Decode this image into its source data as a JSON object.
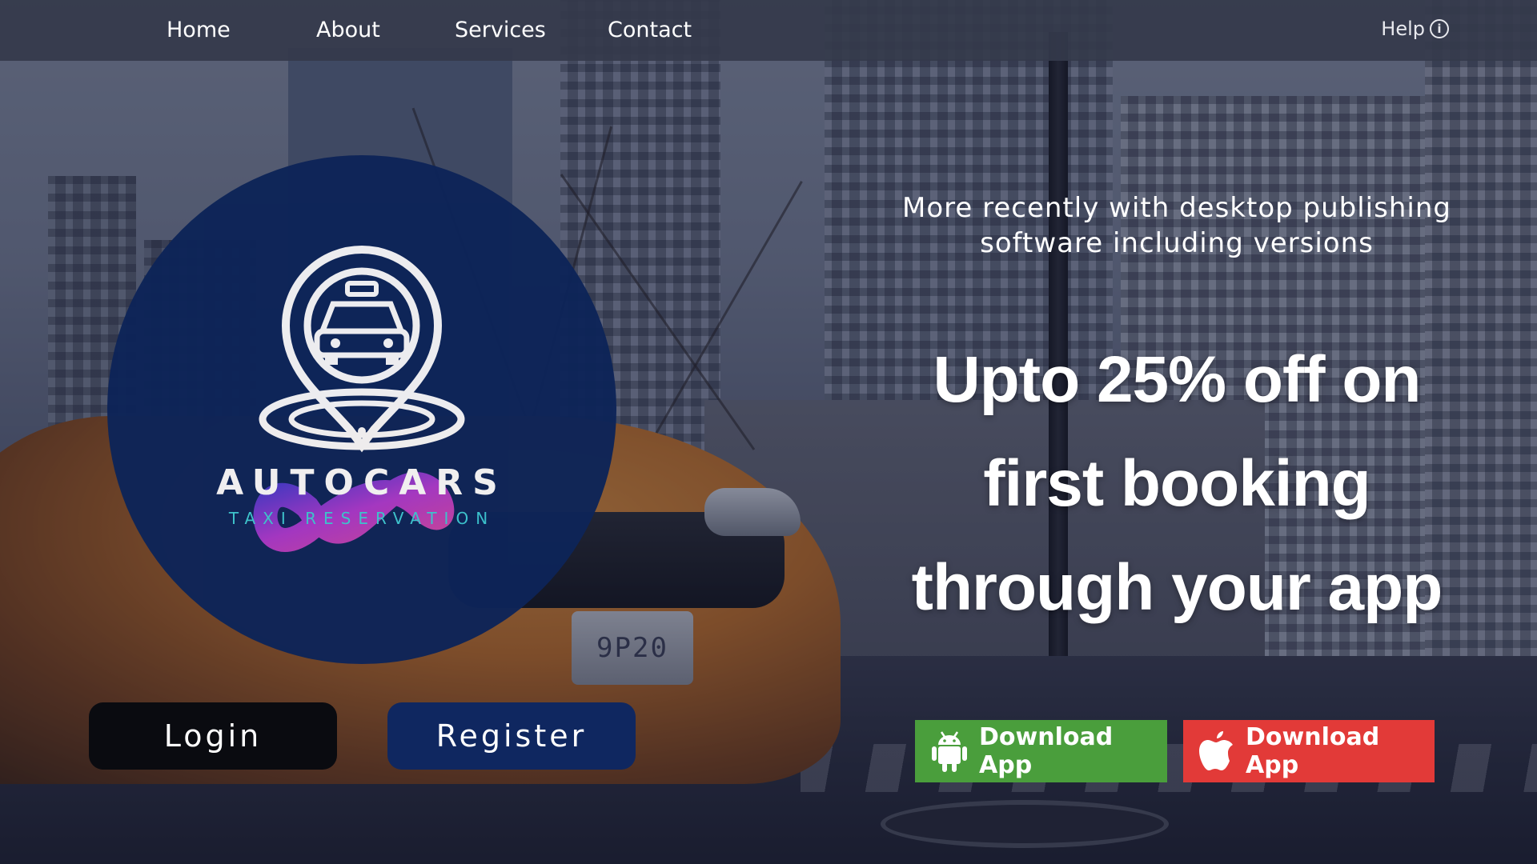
{
  "nav": {
    "items": [
      {
        "label": "Home"
      },
      {
        "label": "About"
      },
      {
        "label": "Services"
      },
      {
        "label": "Contact"
      }
    ],
    "help": {
      "label": "Help",
      "icon": "info-icon"
    }
  },
  "logo": {
    "brand": "AUTOCARS",
    "tagline": "TAXI RESERVATION",
    "icon": "taxi-location-pin-icon",
    "colors": {
      "circle": "#0d2458",
      "tagline": "#3cc6d0",
      "infinity": "#b83ad8"
    }
  },
  "auth": {
    "login_label": "Login",
    "register_label": "Register"
  },
  "promo": {
    "subtitle": "More recently with desktop publishing software including versions",
    "headline_line1": "Upto 25% off on",
    "headline_line2": "first booking",
    "headline_line3": "through your app"
  },
  "downloads": {
    "android": {
      "label": "Download App",
      "icon": "android-icon",
      "color": "#4a9e3c"
    },
    "apple": {
      "label": "Download App",
      "icon": "apple-icon",
      "color": "#e23a38"
    }
  },
  "background": {
    "plate_text": "9P20"
  }
}
